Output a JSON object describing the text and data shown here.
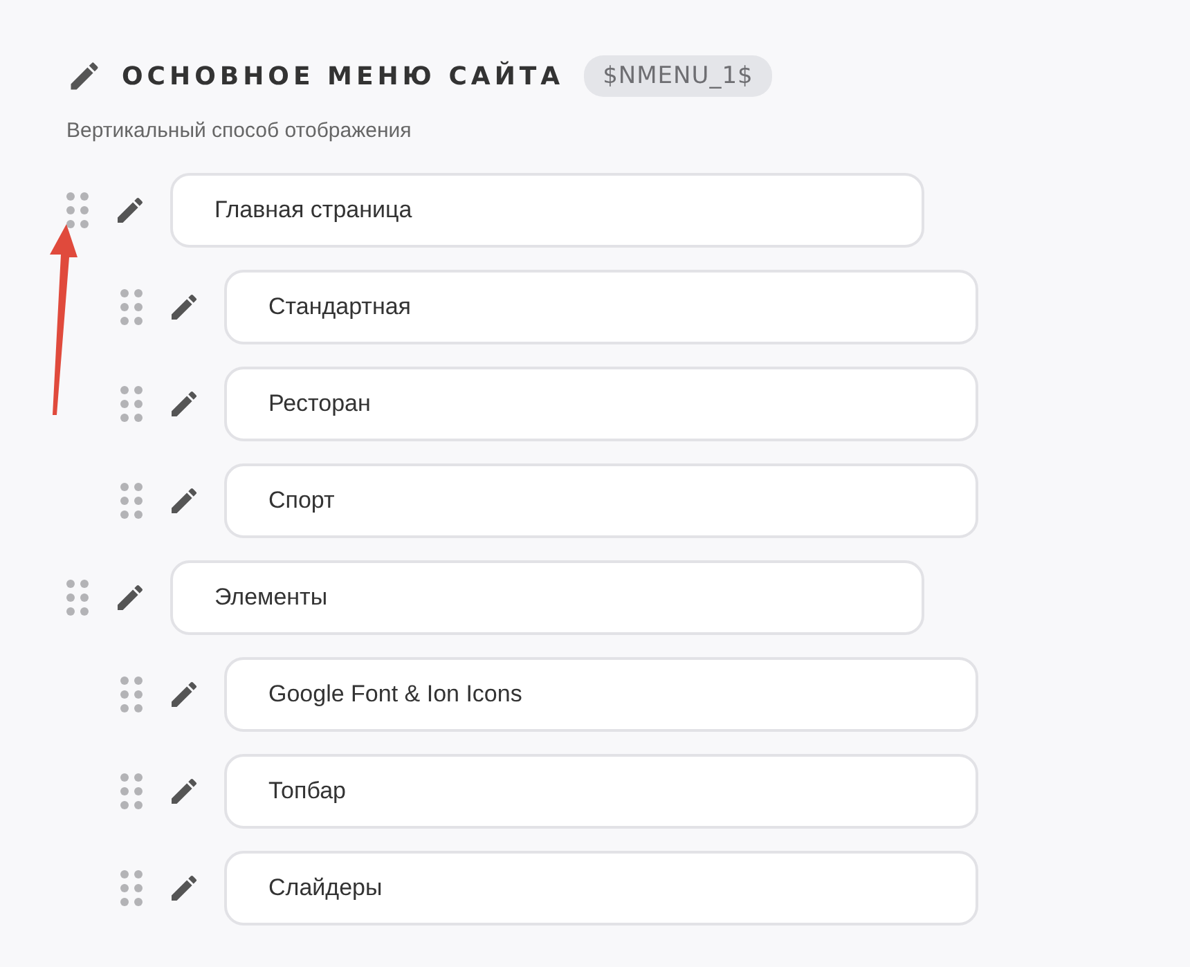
{
  "header": {
    "title": "ОСНОВНОЕ МЕНЮ САЙТА",
    "badge": "$NMENU_1$",
    "subtitle": "Вертикальный способ отображения"
  },
  "menu_items": [
    {
      "label": "Главная страница",
      "children": [
        {
          "label": "Стандартная"
        },
        {
          "label": "Ресторан"
        },
        {
          "label": "Спорт"
        }
      ]
    },
    {
      "label": "Элементы",
      "children": [
        {
          "label": "Google Font & Ion Icons"
        },
        {
          "label": "Топбар"
        },
        {
          "label": "Слайдеры"
        }
      ]
    }
  ]
}
